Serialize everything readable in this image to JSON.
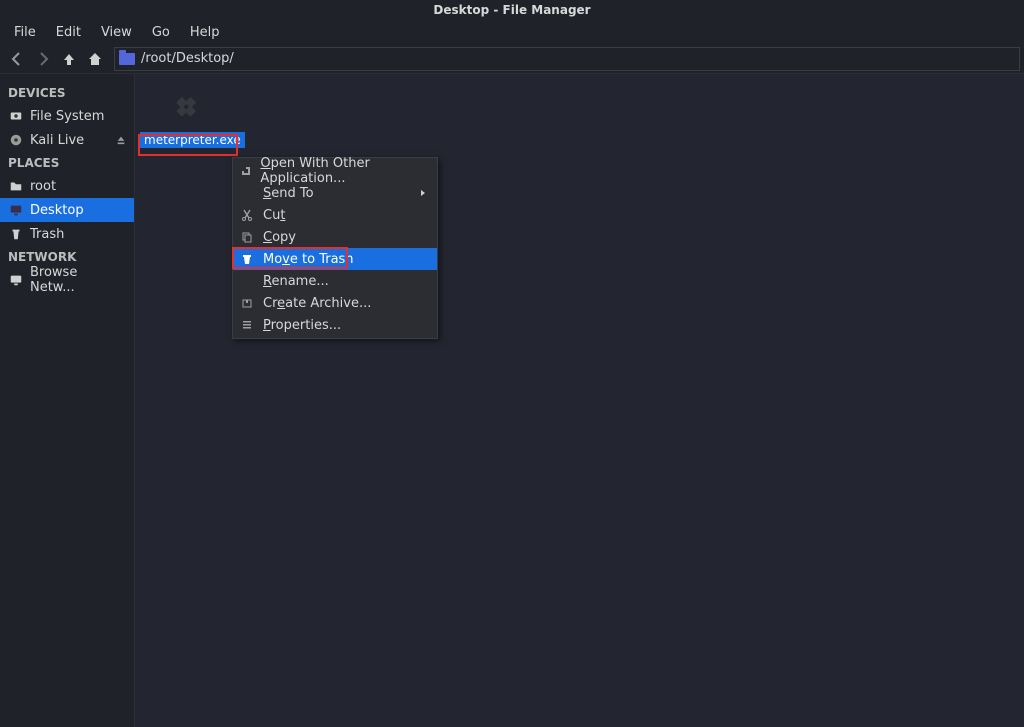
{
  "window": {
    "title": "Desktop - File Manager"
  },
  "menubar": {
    "file": "File",
    "edit": "Edit",
    "view": "View",
    "go": "Go",
    "help": "Help"
  },
  "path": {
    "value": "/root/Desktop/"
  },
  "sidebar": {
    "devices_header": "DEVICES",
    "devices": [
      {
        "label": "File System"
      },
      {
        "label": "Kali Live"
      }
    ],
    "places_header": "PLACES",
    "places": [
      {
        "label": "root"
      },
      {
        "label": "Desktop"
      },
      {
        "label": "Trash"
      }
    ],
    "network_header": "NETWORK",
    "network": [
      {
        "label": "Browse Netw..."
      }
    ]
  },
  "file": {
    "name": "meterpreter.exe"
  },
  "context_menu": {
    "open_with": "Open With Other Application...",
    "send_to": "Send To",
    "cut": "Cut",
    "copy": "Copy",
    "move_to_trash": "Move to Trash",
    "rename": "Rename...",
    "create_archive": "Create Archive...",
    "properties": "Properties..."
  }
}
